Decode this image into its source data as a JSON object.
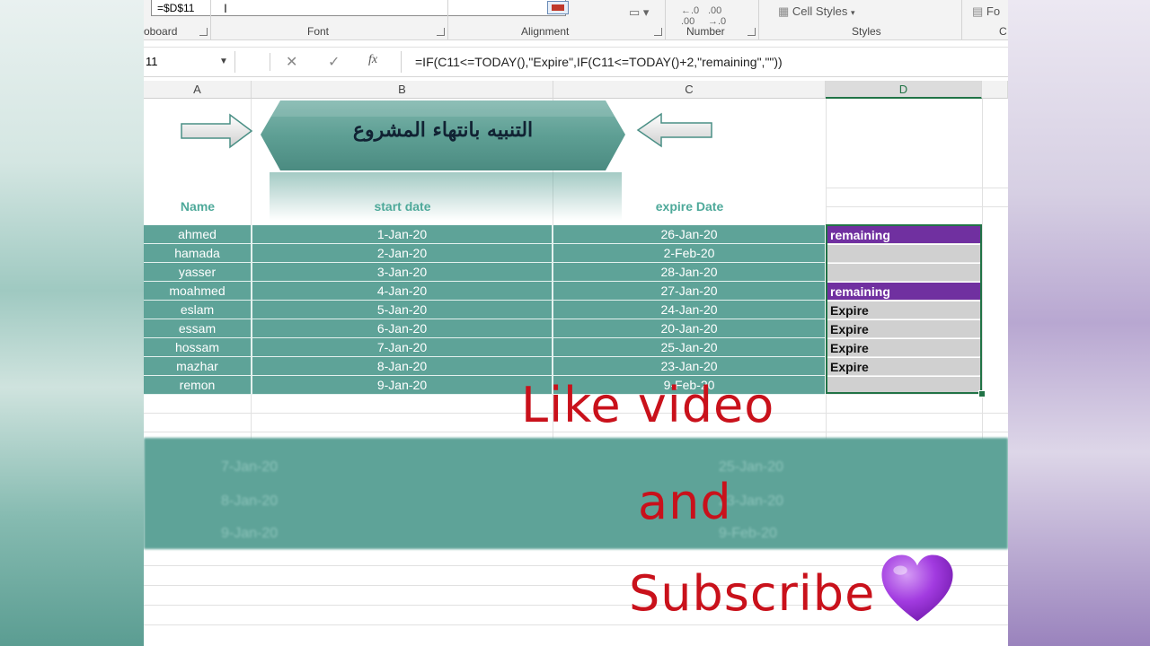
{
  "ribbon": {
    "name_box_value": "=$D$11",
    "groups": [
      "oboard",
      "Font",
      "Alignment",
      "Number",
      "Styles",
      "C"
    ],
    "cell_styles_label": "Cell Styles",
    "format_label": "Fo"
  },
  "formula_bar": {
    "name_box": "11",
    "cancel_icon": "✕",
    "enter_icon": "✓",
    "fx_label": "fx",
    "formula": "=IF(C11<=TODAY(),\"Expire\",IF(C11<=TODAY()+2,\"remaining\",\"\"))"
  },
  "columns": [
    "A",
    "B",
    "C",
    "D"
  ],
  "banner": {
    "title": "التنبيه بانتهاء المشروع"
  },
  "table": {
    "headers": [
      "Name",
      "start date",
      "expire Date"
    ],
    "rows": [
      {
        "name": "ahmed",
        "start": "1-Jan-20",
        "expire": "26-Jan-20",
        "status": "remaining"
      },
      {
        "name": "hamada",
        "start": "2-Jan-20",
        "expire": "2-Feb-20",
        "status": ""
      },
      {
        "name": "yasser",
        "start": "3-Jan-20",
        "expire": "28-Jan-20",
        "status": ""
      },
      {
        "name": "moahmed",
        "start": "4-Jan-20",
        "expire": "27-Jan-20",
        "status": "remaining"
      },
      {
        "name": "eslam",
        "start": "5-Jan-20",
        "expire": "24-Jan-20",
        "status": "Expire"
      },
      {
        "name": "essam",
        "start": "6-Jan-20",
        "expire": "20-Jan-20",
        "status": "Expire"
      },
      {
        "name": "hossam",
        "start": "7-Jan-20",
        "expire": "25-Jan-20",
        "status": "Expire"
      },
      {
        "name": "mazhar",
        "start": "8-Jan-20",
        "expire": "23-Jan-20",
        "status": "Expire"
      },
      {
        "name": "remon",
        "start": "9-Jan-20",
        "expire": "9-Feb-20",
        "status": ""
      }
    ]
  },
  "reflection": {
    "rows": [
      {
        "start": "7-Jan-20",
        "expire": "25-Jan-20"
      },
      {
        "start": "8-Jan-20",
        "expire": "23-Jan-20"
      },
      {
        "start": "9-Jan-20",
        "expire": "9-Feb-20"
      }
    ]
  },
  "overlay": {
    "line1": "Like video",
    "line2": "and",
    "line3": "Subscribe"
  },
  "icons": {
    "heart": "purple-heart-icon",
    "arrow_right": "arrow-right-icon",
    "arrow_left": "arrow-left-icon"
  },
  "colors": {
    "teal": "#5ea398",
    "purple": "#7030a0",
    "red_text": "#c9111b",
    "excel_green": "#217346"
  }
}
